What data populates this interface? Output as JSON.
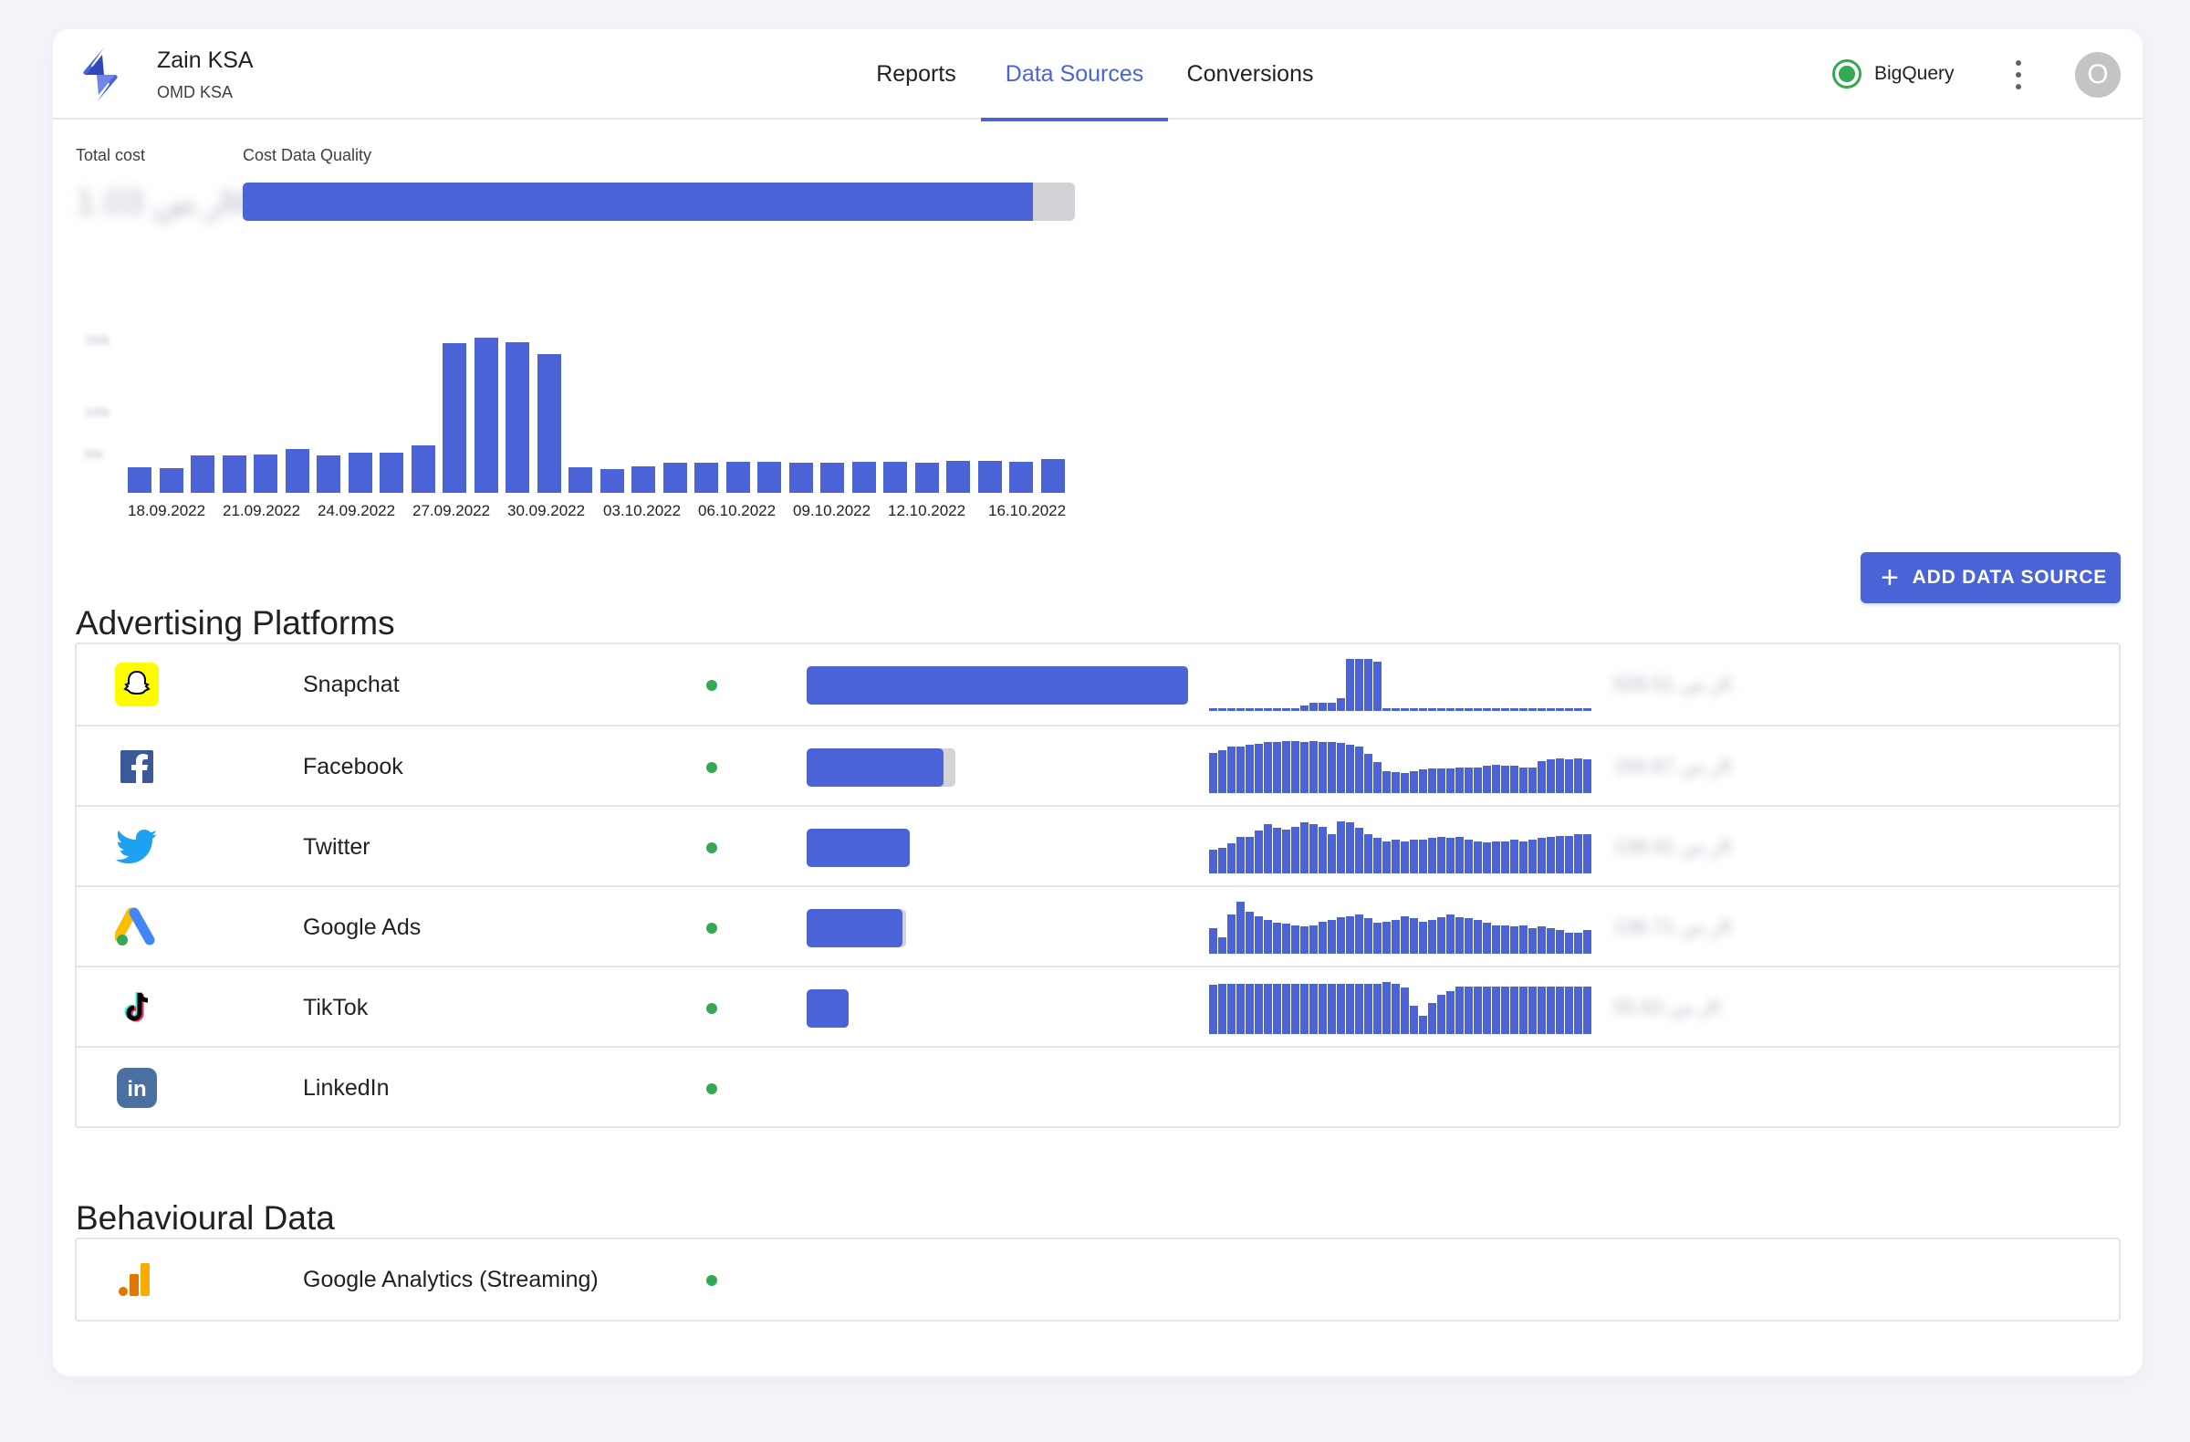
{
  "account": {
    "name": "Zain KSA",
    "subtitle": "OMD KSA"
  },
  "nav": {
    "tabs": [
      {
        "label": "Reports",
        "active": false
      },
      {
        "label": "Data Sources",
        "active": true
      },
      {
        "label": "Conversions",
        "active": false
      }
    ]
  },
  "warehouse": {
    "label": "BigQuery",
    "status_color": "#34a853"
  },
  "avatar": {
    "initial": "O"
  },
  "summary": {
    "total_cost_label": "Total cost",
    "total_cost_value": "1.03 ﺭ.ﺱM",
    "quality_label": "Cost Data Quality",
    "quality_fraction": 0.95
  },
  "colors": {
    "accent": "#4a63d6",
    "bar_track": "#d2d3d6",
    "status_ok": "#34a853"
  },
  "chart_data": {
    "type": "bar",
    "title": "",
    "xlabel": "",
    "ylabel": "",
    "ylim": [
      0,
      150000
    ],
    "y_ticks": [
      "150k",
      "100k",
      "50k"
    ],
    "x_tick_labels": [
      "18.09.2022",
      "21.09.2022",
      "24.09.2022",
      "27.09.2022",
      "30.09.2022",
      "03.10.2022",
      "06.10.2022",
      "09.10.2022",
      "12.10.2022",
      "16.10.2022"
    ],
    "values": [
      25000,
      24000,
      36000,
      36000,
      37000,
      42000,
      36000,
      39000,
      39000,
      46000,
      145000,
      150000,
      146000,
      134000,
      25000,
      23000,
      26000,
      29000,
      29000,
      30000,
      30000,
      29000,
      29000,
      30000,
      30000,
      29000,
      31000,
      31000,
      30000,
      33000
    ]
  },
  "sections": {
    "advertising_title": "Advertising Platforms",
    "behavioural_title": "Behavioural Data"
  },
  "add_button": {
    "label": "ADD DATA SOURCE"
  },
  "platforms": [
    {
      "name": "Snapchat",
      "icon": "snapchat-icon",
      "brand_color": "#fffc00",
      "cost_fraction": 1.0,
      "quality_fraction": 1.0,
      "cost_label": "509.51 ﺭ.ﺱK",
      "spark": [
        0.05,
        0.05,
        0.05,
        0.05,
        0.05,
        0.05,
        0.05,
        0.05,
        0.05,
        0.05,
        0.1,
        0.15,
        0.15,
        0.15,
        0.25,
        1.0,
        1.0,
        1.0,
        0.95,
        0.05,
        0.05,
        0.05,
        0.05,
        0.05,
        0.05,
        0.05,
        0.05,
        0.05,
        0.05,
        0.05,
        0.05,
        0.05,
        0.05,
        0.05,
        0.05,
        0.05,
        0.05,
        0.05,
        0.05,
        0.05,
        0.05,
        0.05
      ]
    },
    {
      "name": "Facebook",
      "icon": "facebook-icon",
      "brand_color": "#3b5998",
      "cost_fraction": 0.39,
      "quality_fraction": 0.36,
      "cost_label": "194.67 ﺭ.ﺱK",
      "spark": [
        0.78,
        0.82,
        0.9,
        0.9,
        0.93,
        0.95,
        0.98,
        0.98,
        1.0,
        1.0,
        0.98,
        1.0,
        0.98,
        0.98,
        0.97,
        0.93,
        0.9,
        0.75,
        0.6,
        0.42,
        0.4,
        0.38,
        0.42,
        0.45,
        0.48,
        0.48,
        0.48,
        0.5,
        0.5,
        0.5,
        0.52,
        0.55,
        0.52,
        0.52,
        0.5,
        0.5,
        0.62,
        0.65,
        0.67,
        0.65,
        0.67,
        0.65
      ]
    },
    {
      "name": "Twitter",
      "icon": "twitter-icon",
      "brand_color": "#1da1f2",
      "cost_fraction": 0.27,
      "quality_fraction": 0.27,
      "cost_label": "138.91 ﺭ.ﺱK",
      "spark": [
        0.45,
        0.5,
        0.58,
        0.7,
        0.7,
        0.82,
        0.95,
        0.88,
        0.85,
        0.9,
        0.98,
        0.95,
        0.9,
        0.75,
        1.0,
        0.98,
        0.88,
        0.75,
        0.68,
        0.62,
        0.65,
        0.62,
        0.65,
        0.65,
        0.68,
        0.7,
        0.68,
        0.7,
        0.65,
        0.62,
        0.6,
        0.62,
        0.62,
        0.65,
        0.62,
        0.65,
        0.68,
        0.7,
        0.72,
        0.72,
        0.75,
        0.75
      ]
    },
    {
      "name": "Google Ads",
      "icon": "google-ads-icon",
      "brand_color": "#fbbc04",
      "cost_fraction": 0.26,
      "quality_fraction": 0.25,
      "cost_label": "136.71 ﺭ.ﺱK",
      "spark": [
        0.5,
        0.32,
        0.75,
        1.0,
        0.8,
        0.72,
        0.65,
        0.6,
        0.58,
        0.55,
        0.52,
        0.55,
        0.62,
        0.65,
        0.7,
        0.72,
        0.75,
        0.68,
        0.6,
        0.62,
        0.65,
        0.72,
        0.68,
        0.62,
        0.65,
        0.7,
        0.75,
        0.7,
        0.68,
        0.65,
        0.6,
        0.55,
        0.55,
        0.52,
        0.55,
        0.5,
        0.52,
        0.5,
        0.45,
        0.4,
        0.4,
        0.45
      ]
    },
    {
      "name": "TikTok",
      "icon": "tiktok-icon",
      "brand_color": "#000000",
      "cost_fraction": 0.11,
      "quality_fraction": 0.11,
      "cost_label": "55.62 ﺭ.ﺱK",
      "spark": [
        0.95,
        0.97,
        0.97,
        0.97,
        0.97,
        0.97,
        0.97,
        0.97,
        0.97,
        0.97,
        0.97,
        0.97,
        0.97,
        0.97,
        0.97,
        0.97,
        0.97,
        0.97,
        0.97,
        1.0,
        0.97,
        0.9,
        0.55,
        0.35,
        0.6,
        0.75,
        0.82,
        0.92,
        0.92,
        0.92,
        0.92,
        0.92,
        0.92,
        0.92,
        0.92,
        0.92,
        0.92,
        0.92,
        0.92,
        0.92,
        0.92,
        0.92
      ]
    },
    {
      "name": "LinkedIn",
      "icon": "linkedin-icon",
      "brand_color": "#4a6fa1",
      "cost_fraction": 0,
      "quality_fraction": 0,
      "cost_label": "",
      "spark": []
    }
  ],
  "behavioural": [
    {
      "name": "Google Analytics (Streaming)",
      "icon": "google-analytics-icon",
      "brand_color": "#f9ab00"
    }
  ]
}
